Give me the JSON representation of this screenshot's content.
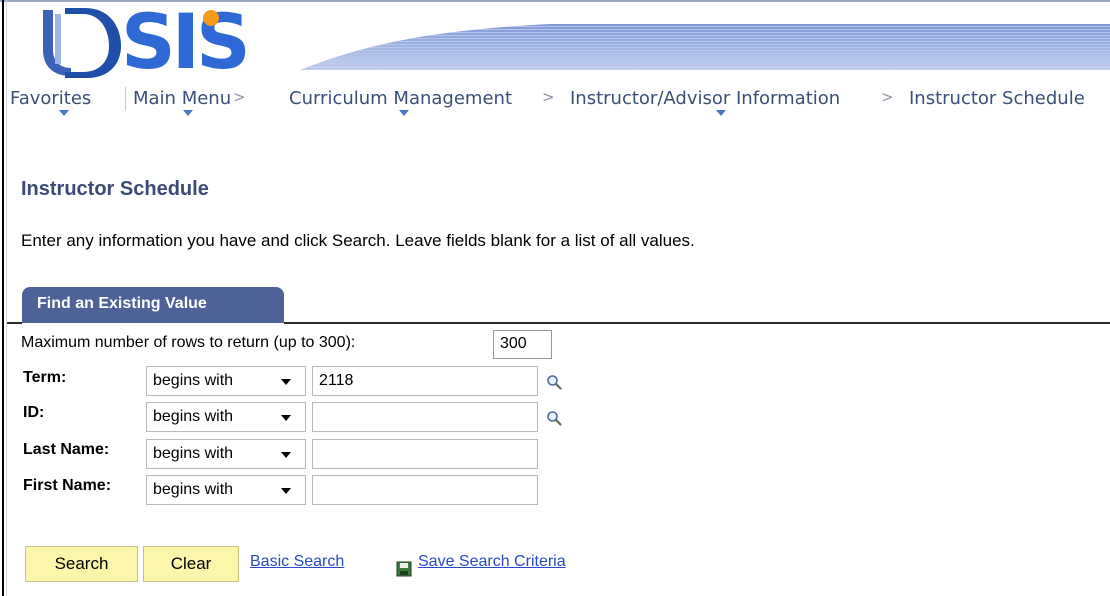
{
  "logo": {
    "text": "SIS"
  },
  "nav": {
    "favorites": "Favorites",
    "main_menu": "Main Menu",
    "curriculum": "Curriculum Management",
    "instructor_advisor": "Instructor/Advisor Information",
    "instructor_schedule": "Instructor Schedule",
    "separator": ">"
  },
  "page": {
    "title": "Instructor Schedule",
    "instructions": "Enter any information you have and click Search. Leave fields blank for a list of all values."
  },
  "tab": {
    "label": "Find an Existing Value"
  },
  "form": {
    "max_rows_label": "Maximum number of rows to return (up to 300):",
    "max_rows_value": "300",
    "fields": [
      {
        "label": "Term:",
        "operator": "begins with",
        "value": "2118",
        "lookup": true
      },
      {
        "label": "ID:",
        "operator": "begins with",
        "value": "",
        "lookup": true
      },
      {
        "label": "Last Name:",
        "operator": "begins with",
        "value": "",
        "lookup": false
      },
      {
        "label": "First Name:",
        "operator": "begins with",
        "value": "",
        "lookup": false
      }
    ]
  },
  "actions": {
    "search": "Search",
    "clear": "Clear",
    "basic_search": "Basic Search",
    "save_criteria": "Save Search Criteria"
  },
  "colors": {
    "nav_text": "#3a4f78",
    "title": "#3c4b76",
    "tab_bg": "#4d6296",
    "button_bg": "#fbf6a9",
    "link": "#2a49c7"
  }
}
